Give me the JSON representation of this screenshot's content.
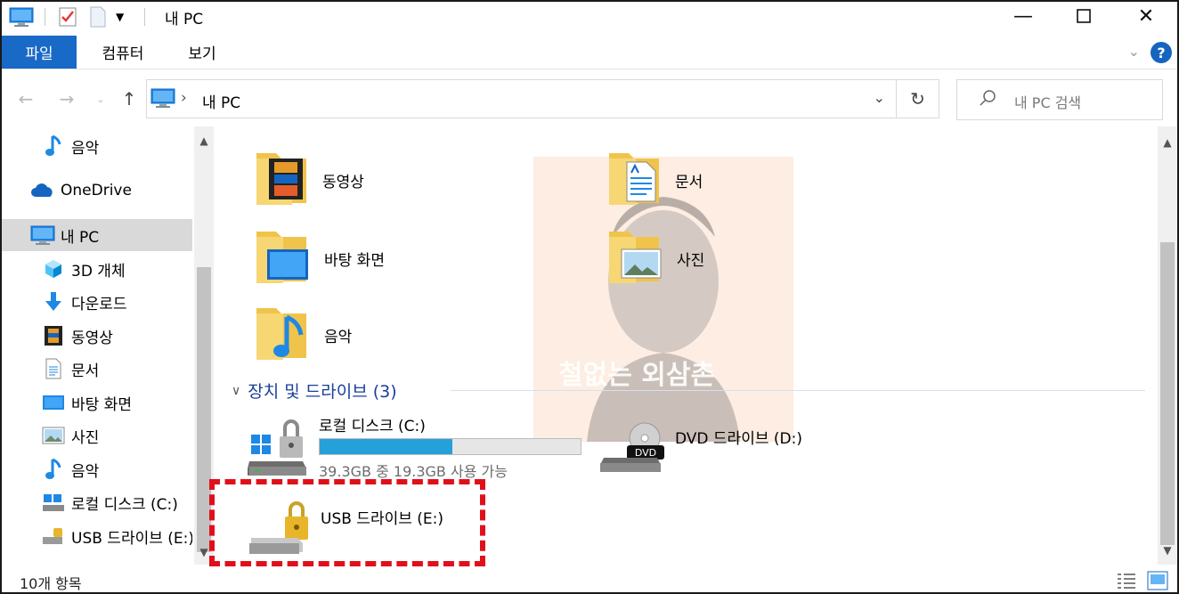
{
  "window": {
    "title": "내 PC"
  },
  "ribbon": {
    "tabs": [
      {
        "label": "파일"
      },
      {
        "label": "컴퓨터"
      },
      {
        "label": "보기"
      }
    ],
    "help": "?"
  },
  "address": {
    "path": "내 PC"
  },
  "search": {
    "placeholder": "내 PC 검색"
  },
  "nav": {
    "items": [
      {
        "label": "음악",
        "icon": "music-icon"
      },
      {
        "label": "OneDrive",
        "icon": "cloud-icon"
      },
      {
        "label": "내 PC",
        "icon": "computer-icon",
        "selected": true
      },
      {
        "label": "3D 개체",
        "icon": "cube-icon"
      },
      {
        "label": "다운로드",
        "icon": "download-icon"
      },
      {
        "label": "동영상",
        "icon": "video-icon"
      },
      {
        "label": "문서",
        "icon": "document-icon"
      },
      {
        "label": "바탕 화면",
        "icon": "desktop-icon"
      },
      {
        "label": "사진",
        "icon": "picture-icon"
      },
      {
        "label": "음악",
        "icon": "music-icon"
      },
      {
        "label": "로컬 디스크 (C:)",
        "icon": "local-disk-icon"
      },
      {
        "label": "USB 드라이브 (E:)",
        "icon": "usb-drive-icon"
      }
    ]
  },
  "folders": [
    {
      "label": "동영상",
      "icon": "video-folder-icon"
    },
    {
      "label": "문서",
      "icon": "documents-folder-icon"
    },
    {
      "label": "바탕 화면",
      "icon": "desktop-folder-icon"
    },
    {
      "label": "사진",
      "icon": "pictures-folder-icon"
    },
    {
      "label": "음악",
      "icon": "music-folder-icon"
    }
  ],
  "devices": {
    "header": "장치 및 드라이브 (3)",
    "drives": [
      {
        "name": "로컬 디스크 (C:)",
        "free_text": "39.3GB 중 19.3GB 사용 가능",
        "used_fraction": 0.51,
        "icon": "windows-locked-drive-icon"
      },
      {
        "name": "DVD 드라이브 (D:)",
        "icon": "dvd-drive-icon"
      },
      {
        "name": "USB 드라이브 (E:)",
        "icon": "usb-locked-drive-icon"
      }
    ]
  },
  "watermark": {
    "text": "철없는 외삼촌"
  },
  "status": {
    "count": "10개 항목"
  },
  "colors": {
    "accent": "#1969c6",
    "highlight": "#e0101a",
    "progress": "#26a0da"
  }
}
